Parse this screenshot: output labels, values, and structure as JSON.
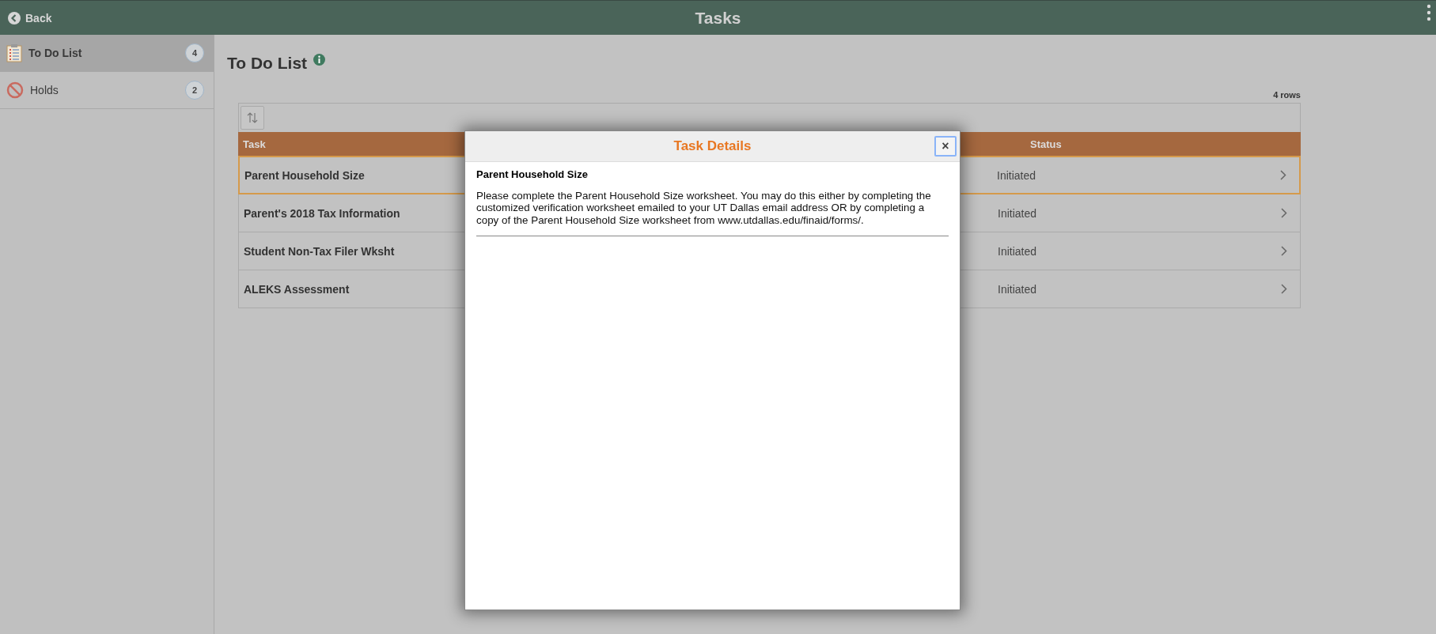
{
  "header": {
    "back": "Back",
    "title": "Tasks"
  },
  "sidebar": {
    "items": [
      {
        "kind": "todo",
        "label": "To Do List",
        "count": "4",
        "selected": true
      },
      {
        "kind": "holds",
        "label": "Holds",
        "count": "2",
        "selected": false
      }
    ]
  },
  "main": {
    "title": "To Do List",
    "row_count": "4 rows"
  },
  "table": {
    "columns": [
      "Task",
      "Status"
    ],
    "rows": [
      {
        "task": "Parent Household Size",
        "status": "Initiated",
        "selected": true
      },
      {
        "task": "Parent's 2018 Tax Information",
        "status": "Initiated",
        "selected": false
      },
      {
        "task": "Student Non-Tax Filer Wksht",
        "status": "Initiated",
        "selected": false
      },
      {
        "task": "ALEKS Assessment",
        "status": "Initiated",
        "selected": false
      }
    ]
  },
  "dialog": {
    "title": "Task Details",
    "close": "×",
    "heading": "Parent Household Size",
    "body": "Please complete the Parent Household Size worksheet. You may do this either by completing the customized verification worksheet emailed to your UT Dallas email address OR by completing a copy of the Parent Household Size worksheet from www.utdallas.edu/finaid/forms/."
  }
}
